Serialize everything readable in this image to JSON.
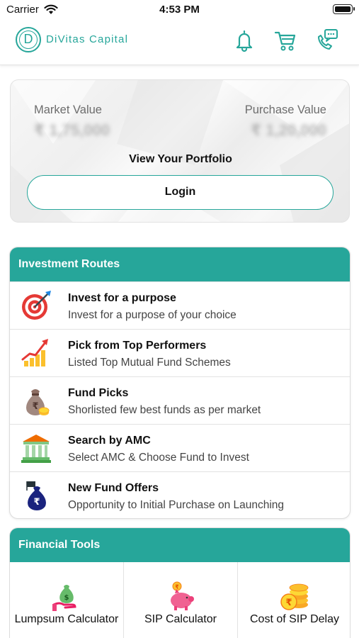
{
  "status_bar": {
    "carrier": "Carrier",
    "time": "4:53 PM"
  },
  "header": {
    "brand": "DiVitas Capital",
    "logo_letter": "D"
  },
  "portfolio": {
    "market_value_label": "Market Value",
    "market_value": "₹ 1,75,000",
    "purchase_value_label": "Purchase Value",
    "purchase_value": "₹ 1,20,000",
    "view_label": "View Your Portfolio",
    "login_label": "Login"
  },
  "investment_routes": {
    "title": "Investment Routes",
    "items": [
      {
        "title": "Invest for a purpose",
        "subtitle": "Invest for a purpose of your choice",
        "icon": "target-icon"
      },
      {
        "title": "Pick from Top Performers",
        "subtitle": "Listed Top Mutual Fund Schemes",
        "icon": "growth-chart-icon"
      },
      {
        "title": "Fund Picks",
        "subtitle": "Shorlisted few best funds as per market",
        "icon": "money-bag-icon"
      },
      {
        "title": "Search by AMC",
        "subtitle": "Select AMC & Choose Fund to Invest",
        "icon": "bank-icon"
      },
      {
        "title": "New Fund Offers",
        "subtitle": "Opportunity to Initial Purchase on Launching",
        "icon": "nfo-bag-icon"
      }
    ]
  },
  "financial_tools": {
    "title": "Financial Tools",
    "items": [
      {
        "label": "Lumpsum Calculator",
        "icon": "lumpsum-icon"
      },
      {
        "label": "SIP Calculator",
        "icon": "piggy-bank-icon"
      },
      {
        "label": "Cost of SIP Delay",
        "icon": "coins-icon"
      }
    ]
  },
  "colors": {
    "accent": "#26a69a",
    "text": "#111111",
    "muted": "#6d6d6d"
  }
}
